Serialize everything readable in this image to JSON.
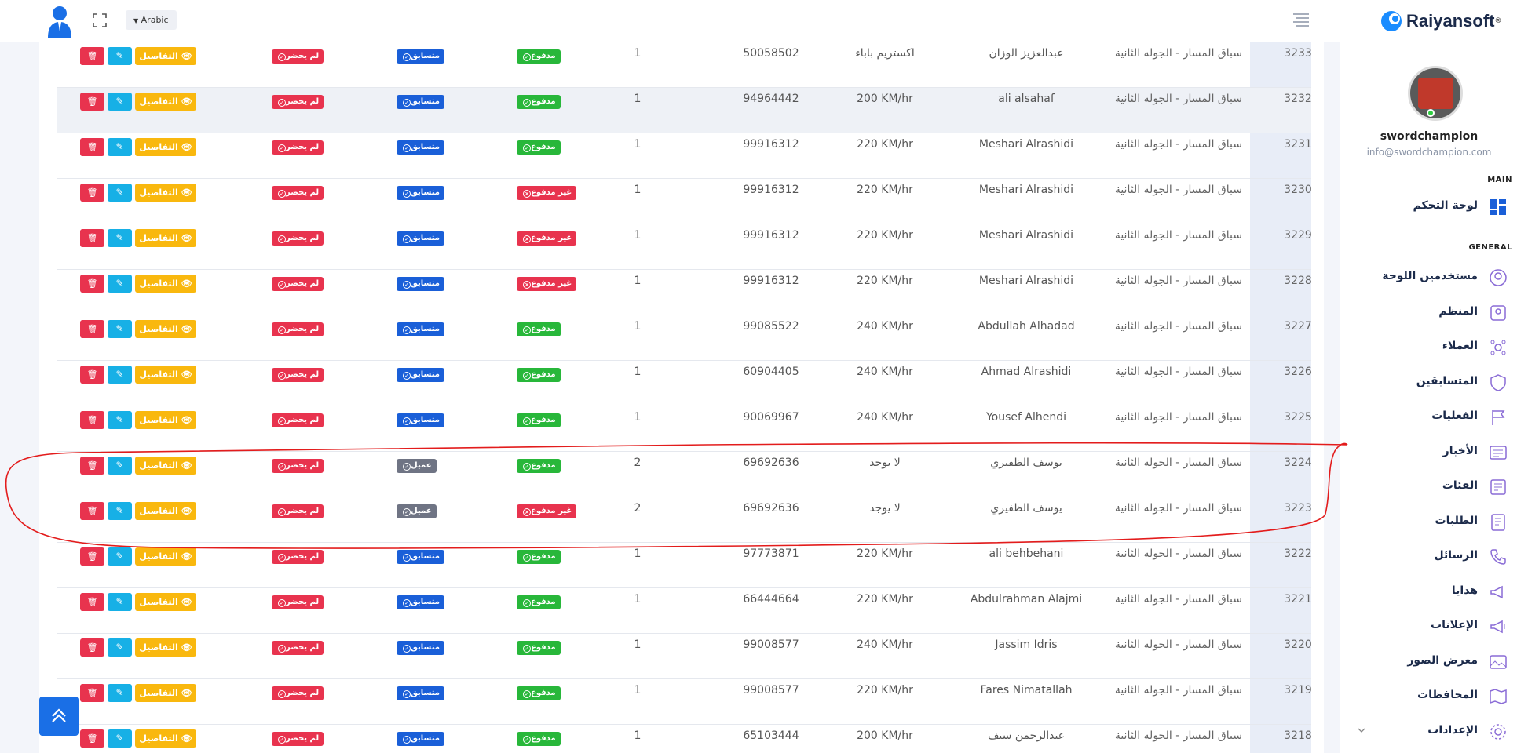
{
  "header": {
    "language_label": "Arabic"
  },
  "brand": {
    "name": "Raiyansoft"
  },
  "profile": {
    "username": "swordchampion",
    "email": "info@swordchampion.com"
  },
  "sidebar": {
    "main_label": "MAIN",
    "general_label": "GENERAL",
    "dashboard": "لوحة التحكم",
    "items": [
      {
        "label": "مستخدمين اللوحة",
        "icon": "user-circle-icon"
      },
      {
        "label": "المنظم",
        "icon": "organizer-icon"
      },
      {
        "label": "العملاء",
        "icon": "clients-icon"
      },
      {
        "label": "المتسابقين",
        "icon": "shield-icon"
      },
      {
        "label": "الفعليات",
        "icon": "flag-icon"
      },
      {
        "label": "الأخبار",
        "icon": "news-icon"
      },
      {
        "label": "الفئات",
        "icon": "categories-icon"
      },
      {
        "label": "الطلبات",
        "icon": "orders-icon"
      },
      {
        "label": "الرسائل",
        "icon": "phone-icon"
      },
      {
        "label": "هدايا",
        "icon": "megaphone-icon"
      },
      {
        "label": "الإعلانات",
        "icon": "ads-icon"
      },
      {
        "label": "معرض الصور",
        "icon": "gallery-icon"
      },
      {
        "label": "المحافظات",
        "icon": "map-icon"
      },
      {
        "label": "الإعدادات",
        "icon": "gear-icon"
      }
    ]
  },
  "table": {
    "details_label": "التفاصيل",
    "rows": [
      {
        "id": "3233",
        "race": "سباق المسار - الجوله الثانية",
        "name": "عبدالعزيز الوزان",
        "car": "اكستريم باباء",
        "phone": "50058502",
        "qty": "1",
        "payment": "مدفوع",
        "payment_paid": true,
        "type": "متسابق",
        "attendance": "لم يحضر"
      },
      {
        "id": "3232",
        "race": "سباق المسار - الجوله الثانية",
        "name": "ali alsahaf",
        "car": "200 KM/hr",
        "phone": "94964442",
        "qty": "1",
        "payment": "مدفوع",
        "payment_paid": true,
        "type": "متسابق",
        "attendance": "لم يحضر"
      },
      {
        "id": "3231",
        "race": "سباق المسار - الجوله الثانية",
        "name": "Meshari Alrashidi",
        "car": "220 KM/hr",
        "phone": "99916312",
        "qty": "1",
        "payment": "مدفوع",
        "payment_paid": true,
        "type": "متسابق",
        "attendance": "لم يحضر"
      },
      {
        "id": "3230",
        "race": "سباق المسار - الجوله الثانية",
        "name": "Meshari Alrashidi",
        "car": "220 KM/hr",
        "phone": "99916312",
        "qty": "1",
        "payment": "غير مدفوع",
        "payment_paid": false,
        "type": "متسابق",
        "attendance": "لم يحضر"
      },
      {
        "id": "3229",
        "race": "سباق المسار - الجوله الثانية",
        "name": "Meshari Alrashidi",
        "car": "220 KM/hr",
        "phone": "99916312",
        "qty": "1",
        "payment": "غير مدفوع",
        "payment_paid": false,
        "type": "متسابق",
        "attendance": "لم يحضر"
      },
      {
        "id": "3228",
        "race": "سباق المسار - الجوله الثانية",
        "name": "Meshari Alrashidi",
        "car": "220 KM/hr",
        "phone": "99916312",
        "qty": "1",
        "payment": "غير مدفوع",
        "payment_paid": false,
        "type": "متسابق",
        "attendance": "لم يحضر"
      },
      {
        "id": "3227",
        "race": "سباق المسار - الجوله الثانية",
        "name": "Abdullah Alhadad",
        "car": "240 KM/hr",
        "phone": "99085522",
        "qty": "1",
        "payment": "مدفوع",
        "payment_paid": true,
        "type": "متسابق",
        "attendance": "لم يحضر"
      },
      {
        "id": "3226",
        "race": "سباق المسار - الجوله الثانية",
        "name": "Ahmad Alrashidi",
        "car": "240 KM/hr",
        "phone": "60904405",
        "qty": "1",
        "payment": "مدفوع",
        "payment_paid": true,
        "type": "متسابق",
        "attendance": "لم يحضر"
      },
      {
        "id": "3225",
        "race": "سباق المسار - الجوله الثانية",
        "name": "Yousef Alhendi",
        "car": "240 KM/hr",
        "phone": "90069967",
        "qty": "1",
        "payment": "مدفوع",
        "payment_paid": true,
        "type": "متسابق",
        "attendance": "لم يحضر"
      },
      {
        "id": "3224",
        "race": "سباق المسار - الجوله الثانية",
        "name": "يوسف الظفيري",
        "car": "لا يوجد",
        "phone": "69692636",
        "qty": "2",
        "payment": "مدفوع",
        "payment_paid": true,
        "type": "عميل",
        "attendance": "لم يحضر"
      },
      {
        "id": "3223",
        "race": "سباق المسار - الجوله الثانية",
        "name": "يوسف الظفيري",
        "car": "لا يوجد",
        "phone": "69692636",
        "qty": "2",
        "payment": "غير مدفوع",
        "payment_paid": false,
        "type": "عميل",
        "attendance": "لم يحضر"
      },
      {
        "id": "3222",
        "race": "سباق المسار - الجوله الثانية",
        "name": "ali behbehani",
        "car": "220 KM/hr",
        "phone": "97773871",
        "qty": "1",
        "payment": "مدفوع",
        "payment_paid": true,
        "type": "متسابق",
        "attendance": "لم يحضر"
      },
      {
        "id": "3221",
        "race": "سباق المسار - الجوله الثانية",
        "name": "Abdulrahman Alajmi",
        "car": "220 KM/hr",
        "phone": "66444664",
        "qty": "1",
        "payment": "مدفوع",
        "payment_paid": true,
        "type": "متسابق",
        "attendance": "لم يحضر"
      },
      {
        "id": "3220",
        "race": "سباق المسار - الجوله الثانية",
        "name": "Jassim Idris",
        "car": "240 KM/hr",
        "phone": "99008577",
        "qty": "1",
        "payment": "مدفوع",
        "payment_paid": true,
        "type": "متسابق",
        "attendance": "لم يحضر"
      },
      {
        "id": "3219",
        "race": "سباق المسار - الجوله الثانية",
        "name": "Fares Nimatallah",
        "car": "220 KM/hr",
        "phone": "99008577",
        "qty": "1",
        "payment": "مدفوع",
        "payment_paid": true,
        "type": "متسابق",
        "attendance": "لم يحضر"
      },
      {
        "id": "3218",
        "race": "سباق المسار - الجوله الثانية",
        "name": "عبدالرحمن سيف",
        "car": "200 KM/hr",
        "phone": "65103444",
        "qty": "1",
        "payment": "مدفوع",
        "payment_paid": true,
        "type": "متسابق",
        "attendance": "لم يحضر"
      }
    ]
  },
  "colors": {
    "paid": "#28b73a",
    "unpaid": "#e8334e",
    "competitor": "#1a5fd8",
    "client": "#6f7484",
    "absent": "#e8334e",
    "details": "#f9b80e",
    "edit": "#17b0e6",
    "delete": "#e8334e",
    "annotation": "#e31c1c"
  }
}
